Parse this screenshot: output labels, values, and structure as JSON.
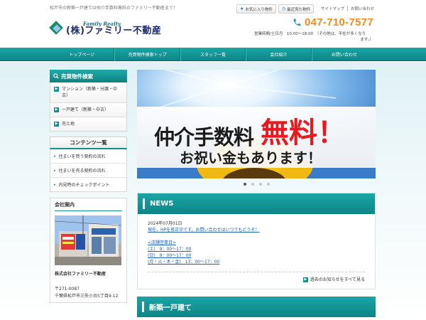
{
  "header": {
    "tagline": "松戸市の新築一戸建ては仲介手数料無料のファミリー不動産まで！",
    "logo_en": "Family Realty",
    "logo_jp": "(株)ファミリー不動産",
    "favorites_label": "お気に入り物件",
    "recent_label": "最近見た物件",
    "sitemap_label": "サイトマップ",
    "contact_link_label": "お問い合わせ",
    "phone": "047-710-7577",
    "hours_line1": "営業時間/土日月　10:00～18:00　（その他は、不在が多くなり",
    "hours_line2": "ます。）"
  },
  "nav": {
    "items": [
      "トップページ",
      "売買物件検索トップ",
      "スタッフ一覧",
      "会社紹介",
      "お問い合わせ"
    ]
  },
  "sidebar": {
    "search_title": "売買物件検索",
    "search_items": [
      "マンション（新築・分譲・中古）",
      "一戸建て（新築・中古）",
      "売土地"
    ],
    "contents_title": "コンテンツ一覧",
    "contents_items": [
      "住まいを買う契約の流れ",
      "住まいを売る契約の流れ",
      "内見時のチェックポイント"
    ],
    "company_title": "会社案内",
    "company_name": "株式会社ファミリー不動産",
    "company_zip": "〒271-0087",
    "company_address": "千葉県松戸市三矢小台5丁目9-12"
  },
  "slider": {
    "banner_line1": "仲介手数料",
    "banner_line1_strong": "無料！",
    "banner_line2": "お祝い金もあります！",
    "active_index": 0,
    "count": 4
  },
  "news": {
    "title": "NEWS",
    "date": "2024年07月01日",
    "headline": "現在、HPを修正中です。お問い合わせはいつでもどうぞ！",
    "schedule_title": "<店舗営業日>",
    "schedule": [
      "(土)　9：00～17：00",
      "(日)　9：00～17：00",
      "(月・火・木・金)　13：00～17：00"
    ],
    "more_label": "過去のお知らせをすべて見る"
  },
  "new_house": {
    "title": "新築一戸建て"
  },
  "colors": {
    "teal": "#109090",
    "orange": "#f08a1c",
    "navy": "#1e2a6b",
    "link": "#1a5fb0"
  }
}
